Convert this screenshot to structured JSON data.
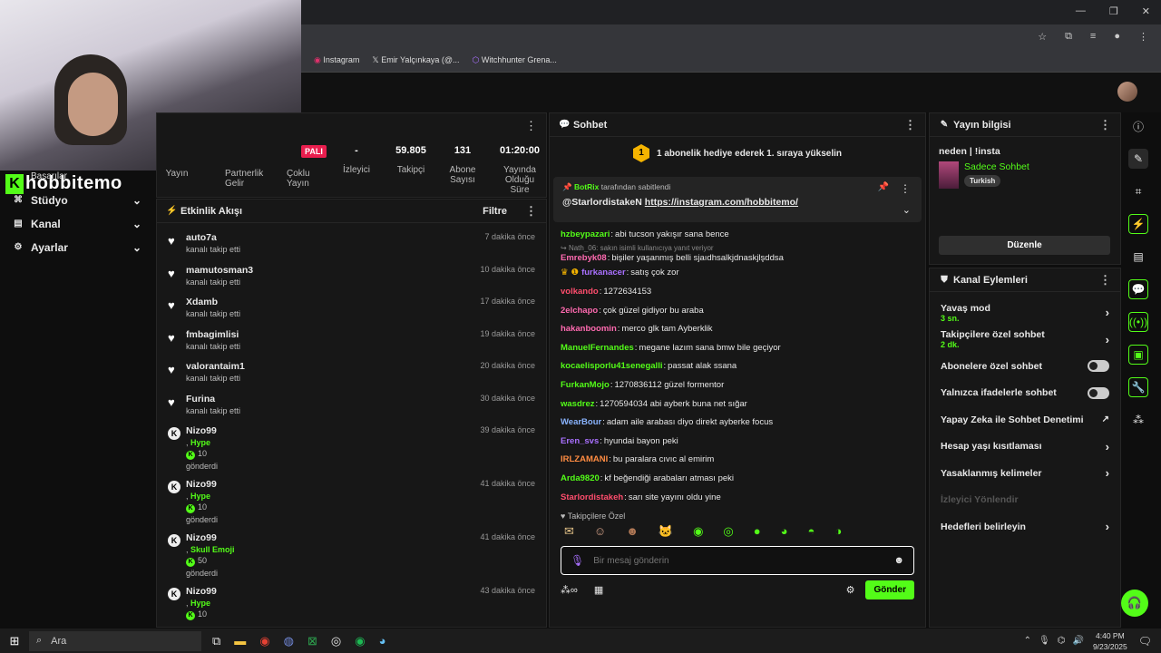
{
  "browser": {
    "bookmarks": [
      {
        "icon": "instagram-icon",
        "label": "Instagram"
      },
      {
        "icon": "x-icon",
        "label": "Emir Yalçınkaya (@..."
      },
      {
        "icon": "witchhunter-icon",
        "label": "Witchhunter Grena..."
      }
    ]
  },
  "overlay": {
    "logo_text": "hobbitemo",
    "badge": "Başarılar"
  },
  "sidebar": {
    "items": [
      {
        "label": "Stüdyo",
        "icon": "studio-icon"
      },
      {
        "label": "Kanal",
        "icon": "channel-icon"
      },
      {
        "label": "Ayarlar",
        "icon": "gear-icon"
      }
    ]
  },
  "stats": {
    "live_badge": "PALI",
    "items": [
      {
        "value": "",
        "label": "Yayın"
      },
      {
        "value": "",
        "label": "Partnerlik Gelir"
      },
      {
        "value": "",
        "label": "Çoklu Yayın"
      },
      {
        "value": "-",
        "label": "İzleyici"
      },
      {
        "value": "59.805",
        "label": "Takipçi"
      },
      {
        "value": "131",
        "label": "Abone Sayısı"
      },
      {
        "value": "01:20:00",
        "label": "Yayında Olduğu Süre"
      }
    ]
  },
  "activity": {
    "title": "Etkinlik Akışı",
    "filter": "Filtre",
    "items": [
      {
        "name": "auto7a",
        "sub": "kanalı takip etti",
        "time": "7 dakika önce",
        "type": "follow"
      },
      {
        "name": "mamutosman3",
        "sub": "kanalı takip etti",
        "time": "10 dakika önce",
        "type": "follow"
      },
      {
        "name": "Xdamb",
        "sub": "kanalı takip etti",
        "time": "17 dakika önce",
        "type": "follow"
      },
      {
        "name": "fmbagimlisi",
        "sub": "kanalı takip etti",
        "time": "19 dakika önce",
        "type": "follow"
      },
      {
        "name": "valorantaim1",
        "sub": "kanalı takip etti",
        "time": "20 dakika önce",
        "type": "follow"
      },
      {
        "name": "Furina",
        "sub": "kanalı takip etti",
        "time": "30 dakika önce",
        "type": "follow"
      },
      {
        "name": "Nizo99",
        "gift": "Hype",
        "amount": "10",
        "sub": "gönderdi",
        "time": "39 dakika önce",
        "type": "gift"
      },
      {
        "name": "Nizo99",
        "gift": "Hype",
        "amount": "10",
        "sub": "gönderdi",
        "time": "41 dakika önce",
        "type": "gift"
      },
      {
        "name": "Nizo99",
        "gift": "Skull Emoji",
        "amount": "50",
        "sub": "gönderdi",
        "time": "41 dakika önce",
        "type": "gift"
      },
      {
        "name": "Nizo99",
        "gift": "Hype",
        "amount": "10",
        "sub": "",
        "time": "43 dakika önce",
        "type": "gift"
      }
    ]
  },
  "chat": {
    "title": "Sohbet",
    "gift_banner_rank": "1",
    "gift_banner": "1 abonelik hediye ederek 1. sıraya yükselin",
    "pinned_by": "BotRix",
    "pinned_suffix": "tarafından sabitlendi",
    "pinned_user": "@StarlordistakeN",
    "pinned_link": "https://instagram.com/hobbitemo/",
    "messages": [
      {
        "user": "hzbeypazari",
        "color": "#53fc18",
        "text": "abi tucson yakışır sana bence"
      },
      {
        "reply": "Nath_06: sakın isimli kullanıcıya yanıt veriyor",
        "user": "Emrebyk08",
        "color": "#ff6ab0",
        "text": "bişiler yaşanmış belli sjaıdhsalkjdnaskjlşddsa"
      },
      {
        "user": "furkanacer",
        "color": "#a970ff",
        "text": "satış çok zor",
        "badges": true
      },
      {
        "user": "volkando",
        "color": "#ff4d6d",
        "text": "1272634153"
      },
      {
        "user": "2elchapo",
        "color": "#ff6ab0",
        "text": "çok güzel gidiyor bu araba"
      },
      {
        "user": "hakanboomin",
        "color": "#ff6ab0",
        "text": "merco glk tam Ayberklik"
      },
      {
        "user": "ManuelFernandes",
        "color": "#53fc18",
        "text": "megane lazım sana bmw bile geçiyor"
      },
      {
        "user": "kocaelisporlu41senegalli",
        "color": "#53fc18",
        "text": "passat alak ssana"
      },
      {
        "user": "FurkanMojo",
        "color": "#53fc18",
        "text": "1270836112 güzel formentor"
      },
      {
        "user": "wasdrez",
        "color": "#53fc18",
        "text": "1270594034 abi ayberk buna net sığar"
      },
      {
        "user": "WearBour",
        "color": "#8ab4ff",
        "text": "adam aile arabası diyo direkt ayberke focus"
      },
      {
        "user": "Eren_svs",
        "color": "#a970ff",
        "text": "hyundai bayon peki"
      },
      {
        "user": "IRLZAMANI",
        "color": "#ff8c42",
        "text": "bu paralara cıvıc al emirim"
      },
      {
        "user": "Arda9820",
        "color": "#53fc18",
        "text": "kf beğendiği arabaları atması peki"
      },
      {
        "user": "Starlordistakeh",
        "color": "#ff4d6d",
        "text": "sarı site yayını oldu yine"
      }
    ],
    "followers_only": "Takipçilere Özel",
    "input_placeholder": "Bir mesaj gönderin",
    "send": "Gönder"
  },
  "stream_info": {
    "title": "Yayın bilgisi",
    "stream_title": "neden | !insta",
    "category": "Sadece Sohbet",
    "tag": "Turkish",
    "edit": "Düzenle"
  },
  "channel_actions": {
    "title": "Kanal Eylemleri",
    "items": [
      {
        "label": "Yavaş mod",
        "sub": "3 sn.",
        "control": "arrow"
      },
      {
        "label": "Takipçilere özel sohbet",
        "sub": "2 dk.",
        "control": "arrow"
      },
      {
        "label": "Abonelere özel sohbet",
        "sub": "",
        "control": "toggle"
      },
      {
        "label": "Yalnızca ifadelerle sohbet",
        "sub": "",
        "control": "toggle"
      },
      {
        "label": "Yapay Zeka ile Sohbet Denetimi",
        "sub": "",
        "control": "external"
      },
      {
        "label": "Hesap yaşı kısıtlaması",
        "sub": "",
        "control": "arrow"
      },
      {
        "label": "Yasaklanmış kelimeler",
        "sub": "",
        "control": "arrow"
      },
      {
        "label": "İzleyici Yönlendir",
        "sub": "",
        "control": "none",
        "disabled": true
      },
      {
        "label": "Hedefleri belirleyin",
        "sub": "",
        "control": "arrow"
      }
    ]
  },
  "taskbar": {
    "search": "Ara",
    "time": "4:40 PM",
    "date": "9/23/2025"
  }
}
